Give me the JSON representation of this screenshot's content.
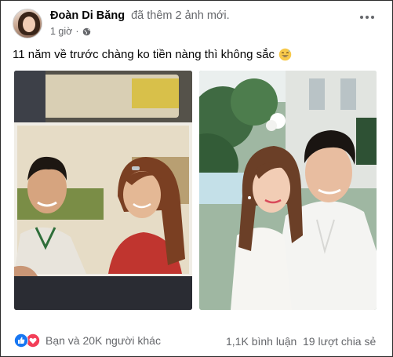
{
  "post": {
    "author_name": "Đoàn Di Băng",
    "action_text": "đã thêm 2 ảnh mới.",
    "timestamp": "1 giờ",
    "separator": "·",
    "audience_icon": "globe-icon",
    "more_icon": "more-options-icon",
    "caption": "11 năm về trước chàng ko tiền nàng thì không sắc",
    "caption_emoji": "grinning-sweat-emoji",
    "photos": [
      {
        "subject": "old-couple-photo"
      },
      {
        "subject": "recent-couple-photo"
      }
    ]
  },
  "footer": {
    "reaction_icons": [
      "like-icon",
      "love-icon"
    ],
    "reaction_text": "Bạn và 20K người khác",
    "comments_text": "1,1K bình luận",
    "shares_text": "19 lượt chia sẻ"
  },
  "colors": {
    "text_primary": "#050505",
    "text_secondary": "#65676b",
    "like_blue": "#1877f2",
    "love_red": "#f33e58"
  }
}
